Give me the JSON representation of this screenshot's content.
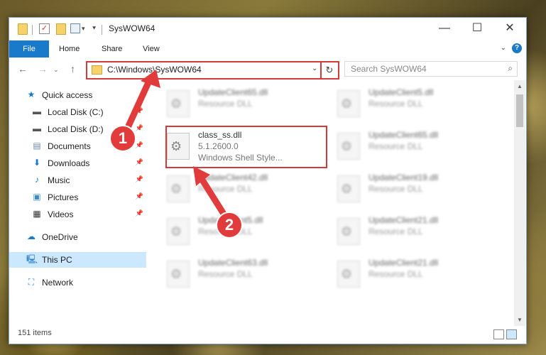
{
  "window": {
    "title": "SysWOW64"
  },
  "ribbon": {
    "tabs": [
      "File",
      "Home",
      "Share",
      "View"
    ],
    "help": "?"
  },
  "address": {
    "path": "C:\\Windows\\SysWOW64",
    "search_placeholder": "Search SysWOW64"
  },
  "sidebar": {
    "items": [
      {
        "label": "Quick access"
      },
      {
        "label": "Local Disk (C:)"
      },
      {
        "label": "Local Disk (D:)"
      },
      {
        "label": "Documents"
      },
      {
        "label": "Downloads"
      },
      {
        "label": "Music"
      },
      {
        "label": "Pictures"
      },
      {
        "label": "Videos"
      },
      {
        "label": "OneDrive"
      },
      {
        "label": "This PC"
      },
      {
        "label": "Network"
      }
    ]
  },
  "files": {
    "highlighted": {
      "name": "class_ss.dll",
      "version": "5.1.2600.0",
      "description": "Windows Shell Style..."
    },
    "tiles": [
      {
        "name": "UpdateClient65.dll",
        "type": "Resource DLL"
      },
      {
        "name": "UpdateClient5.dll",
        "type": "Resource DLL"
      },
      {
        "name": "UpdateClient65.dll",
        "type": "Resource DLL"
      },
      {
        "name": "UpdateClient42.dll",
        "type": "Resource DLL"
      },
      {
        "name": "UpdateClient19.dll",
        "type": "Resource DLL"
      },
      {
        "name": "UpdateClient5.dll",
        "type": "Resource DLL"
      },
      {
        "name": "UpdateClient21.dll",
        "type": "Resource DLL"
      },
      {
        "name": "UpdateClient63.dll",
        "type": "Resource DLL"
      },
      {
        "name": "UpdateClient21.dll",
        "type": "Resource DLL"
      }
    ]
  },
  "status": {
    "item_count": "151 items"
  },
  "markers": [
    "1",
    "2"
  ],
  "colors": {
    "accent": "#1979ca",
    "highlight": "#d43c3c",
    "selected": "#cce8ff"
  }
}
